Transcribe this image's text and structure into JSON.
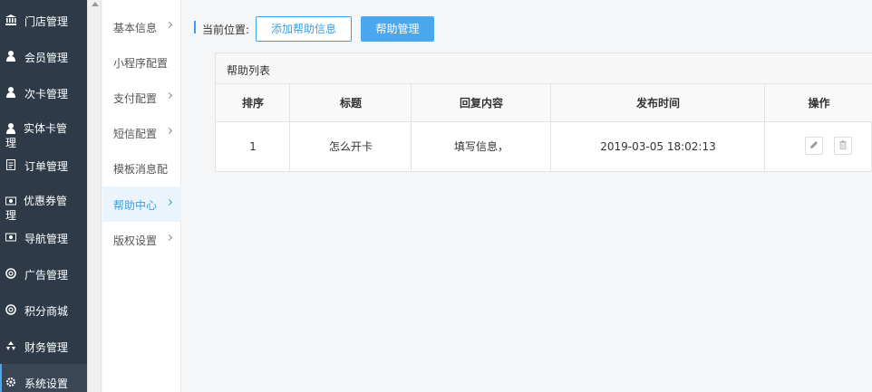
{
  "sidebar": {
    "items": [
      {
        "label": "门店管理",
        "icon": "bank-icon"
      },
      {
        "label": "会员管理",
        "icon": "user-icon"
      },
      {
        "label": "次卡管理",
        "icon": "user-icon"
      },
      {
        "label": "实体卡管理",
        "icon": "user-icon"
      },
      {
        "label": "订单管理",
        "icon": "document-icon"
      },
      {
        "label": "优惠券管理",
        "icon": "money-icon"
      },
      {
        "label": "导航管理",
        "icon": "money-icon"
      },
      {
        "label": "广告管理",
        "icon": "lifebuoy-icon"
      },
      {
        "label": "积分商城",
        "icon": "lifebuoy-icon"
      },
      {
        "label": "财务管理",
        "icon": "recycle-icon"
      },
      {
        "label": "系统设置",
        "icon": "gear-icon"
      }
    ],
    "active_index": 10
  },
  "submenu": {
    "items": [
      {
        "label": "基本信息",
        "chevron": true
      },
      {
        "label": "小程序配置",
        "chevron": false
      },
      {
        "label": "支付配置",
        "chevron": true
      },
      {
        "label": "短信配置",
        "chevron": true
      },
      {
        "label": "模板消息配",
        "chevron": false
      },
      {
        "label": "帮助中心",
        "chevron": true
      },
      {
        "label": "版权设置",
        "chevron": true
      }
    ],
    "active_index": 5
  },
  "breadcrumb": {
    "label": "当前位置:",
    "add_button": "添加帮助信息",
    "manage_button": "帮助管理"
  },
  "panel": {
    "title": "帮助列表",
    "columns": [
      "排序",
      "标题",
      "回复内容",
      "发布时间",
      "操作"
    ],
    "rows": [
      {
        "order": "1",
        "title": "怎么开卡",
        "reply": "填写信息，",
        "time": "2019-03-05 18:02:13"
      }
    ]
  },
  "colors": {
    "sidebar_bg": "#2f3a48",
    "accent": "#3a9fe7",
    "primary_button": "#4aa8ee"
  }
}
